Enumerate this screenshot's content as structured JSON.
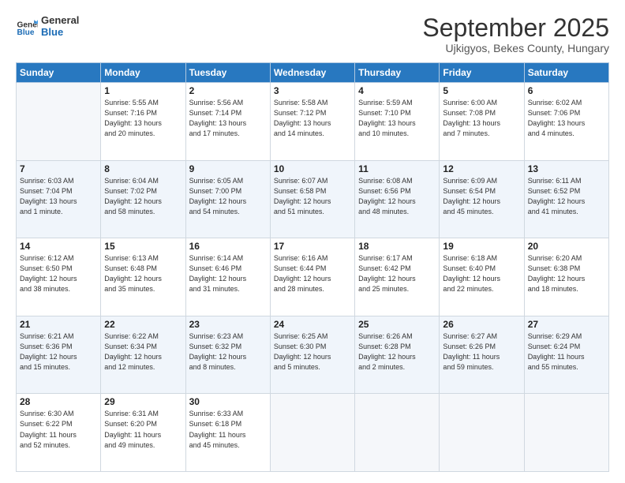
{
  "logo": {
    "line1": "General",
    "line2": "Blue"
  },
  "title": "September 2025",
  "subtitle": "Ujkigyos, Bekes County, Hungary",
  "headers": [
    "Sunday",
    "Monday",
    "Tuesday",
    "Wednesday",
    "Thursday",
    "Friday",
    "Saturday"
  ],
  "weeks": [
    [
      {
        "day": "",
        "info": ""
      },
      {
        "day": "1",
        "info": "Sunrise: 5:55 AM\nSunset: 7:16 PM\nDaylight: 13 hours\nand 20 minutes."
      },
      {
        "day": "2",
        "info": "Sunrise: 5:56 AM\nSunset: 7:14 PM\nDaylight: 13 hours\nand 17 minutes."
      },
      {
        "day": "3",
        "info": "Sunrise: 5:58 AM\nSunset: 7:12 PM\nDaylight: 13 hours\nand 14 minutes."
      },
      {
        "day": "4",
        "info": "Sunrise: 5:59 AM\nSunset: 7:10 PM\nDaylight: 13 hours\nand 10 minutes."
      },
      {
        "day": "5",
        "info": "Sunrise: 6:00 AM\nSunset: 7:08 PM\nDaylight: 13 hours\nand 7 minutes."
      },
      {
        "day": "6",
        "info": "Sunrise: 6:02 AM\nSunset: 7:06 PM\nDaylight: 13 hours\nand 4 minutes."
      }
    ],
    [
      {
        "day": "7",
        "info": "Sunrise: 6:03 AM\nSunset: 7:04 PM\nDaylight: 13 hours\nand 1 minute."
      },
      {
        "day": "8",
        "info": "Sunrise: 6:04 AM\nSunset: 7:02 PM\nDaylight: 12 hours\nand 58 minutes."
      },
      {
        "day": "9",
        "info": "Sunrise: 6:05 AM\nSunset: 7:00 PM\nDaylight: 12 hours\nand 54 minutes."
      },
      {
        "day": "10",
        "info": "Sunrise: 6:07 AM\nSunset: 6:58 PM\nDaylight: 12 hours\nand 51 minutes."
      },
      {
        "day": "11",
        "info": "Sunrise: 6:08 AM\nSunset: 6:56 PM\nDaylight: 12 hours\nand 48 minutes."
      },
      {
        "day": "12",
        "info": "Sunrise: 6:09 AM\nSunset: 6:54 PM\nDaylight: 12 hours\nand 45 minutes."
      },
      {
        "day": "13",
        "info": "Sunrise: 6:11 AM\nSunset: 6:52 PM\nDaylight: 12 hours\nand 41 minutes."
      }
    ],
    [
      {
        "day": "14",
        "info": "Sunrise: 6:12 AM\nSunset: 6:50 PM\nDaylight: 12 hours\nand 38 minutes."
      },
      {
        "day": "15",
        "info": "Sunrise: 6:13 AM\nSunset: 6:48 PM\nDaylight: 12 hours\nand 35 minutes."
      },
      {
        "day": "16",
        "info": "Sunrise: 6:14 AM\nSunset: 6:46 PM\nDaylight: 12 hours\nand 31 minutes."
      },
      {
        "day": "17",
        "info": "Sunrise: 6:16 AM\nSunset: 6:44 PM\nDaylight: 12 hours\nand 28 minutes."
      },
      {
        "day": "18",
        "info": "Sunrise: 6:17 AM\nSunset: 6:42 PM\nDaylight: 12 hours\nand 25 minutes."
      },
      {
        "day": "19",
        "info": "Sunrise: 6:18 AM\nSunset: 6:40 PM\nDaylight: 12 hours\nand 22 minutes."
      },
      {
        "day": "20",
        "info": "Sunrise: 6:20 AM\nSunset: 6:38 PM\nDaylight: 12 hours\nand 18 minutes."
      }
    ],
    [
      {
        "day": "21",
        "info": "Sunrise: 6:21 AM\nSunset: 6:36 PM\nDaylight: 12 hours\nand 15 minutes."
      },
      {
        "day": "22",
        "info": "Sunrise: 6:22 AM\nSunset: 6:34 PM\nDaylight: 12 hours\nand 12 minutes."
      },
      {
        "day": "23",
        "info": "Sunrise: 6:23 AM\nSunset: 6:32 PM\nDaylight: 12 hours\nand 8 minutes."
      },
      {
        "day": "24",
        "info": "Sunrise: 6:25 AM\nSunset: 6:30 PM\nDaylight: 12 hours\nand 5 minutes."
      },
      {
        "day": "25",
        "info": "Sunrise: 6:26 AM\nSunset: 6:28 PM\nDaylight: 12 hours\nand 2 minutes."
      },
      {
        "day": "26",
        "info": "Sunrise: 6:27 AM\nSunset: 6:26 PM\nDaylight: 11 hours\nand 59 minutes."
      },
      {
        "day": "27",
        "info": "Sunrise: 6:29 AM\nSunset: 6:24 PM\nDaylight: 11 hours\nand 55 minutes."
      }
    ],
    [
      {
        "day": "28",
        "info": "Sunrise: 6:30 AM\nSunset: 6:22 PM\nDaylight: 11 hours\nand 52 minutes."
      },
      {
        "day": "29",
        "info": "Sunrise: 6:31 AM\nSunset: 6:20 PM\nDaylight: 11 hours\nand 49 minutes."
      },
      {
        "day": "30",
        "info": "Sunrise: 6:33 AM\nSunset: 6:18 PM\nDaylight: 11 hours\nand 45 minutes."
      },
      {
        "day": "",
        "info": ""
      },
      {
        "day": "",
        "info": ""
      },
      {
        "day": "",
        "info": ""
      },
      {
        "day": "",
        "info": ""
      }
    ]
  ]
}
